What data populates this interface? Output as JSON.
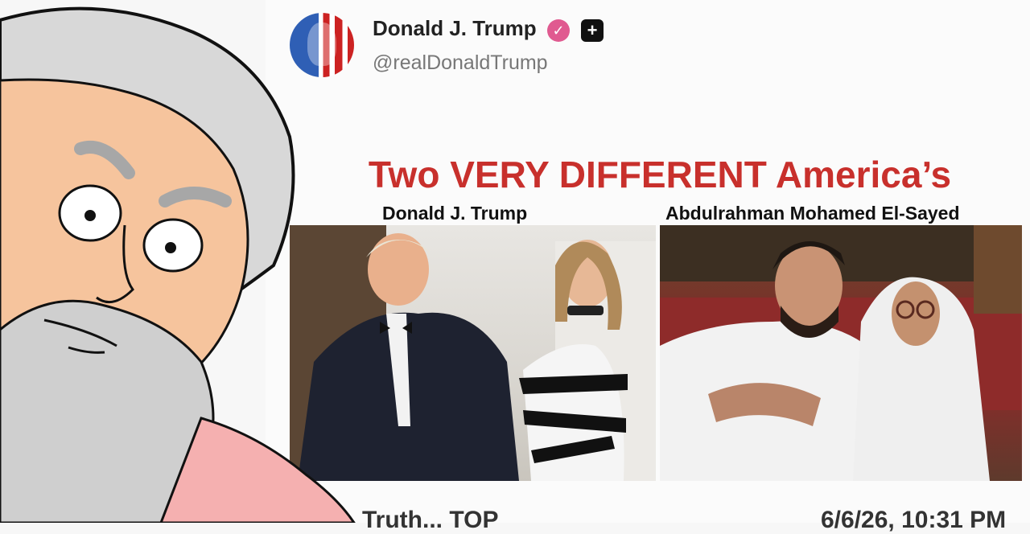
{
  "post": {
    "author_name": "Donald J. Trump",
    "handle": "@realDonaldTrump",
    "verified_icon": "verified-badge-icon",
    "badge_icon": "plus-badge-icon",
    "headline": "Two VERY DIFFERENT America’s",
    "left_label": "Donald J. Trump",
    "right_label": "Abdulrahman Mohamed El-Sayed",
    "colors": {
      "headline": "#c8302c",
      "verified": "#e05a90"
    }
  },
  "footer": {
    "left_text": "Truth... TOP",
    "right_text": "6/6/26, 10:31 PM"
  }
}
